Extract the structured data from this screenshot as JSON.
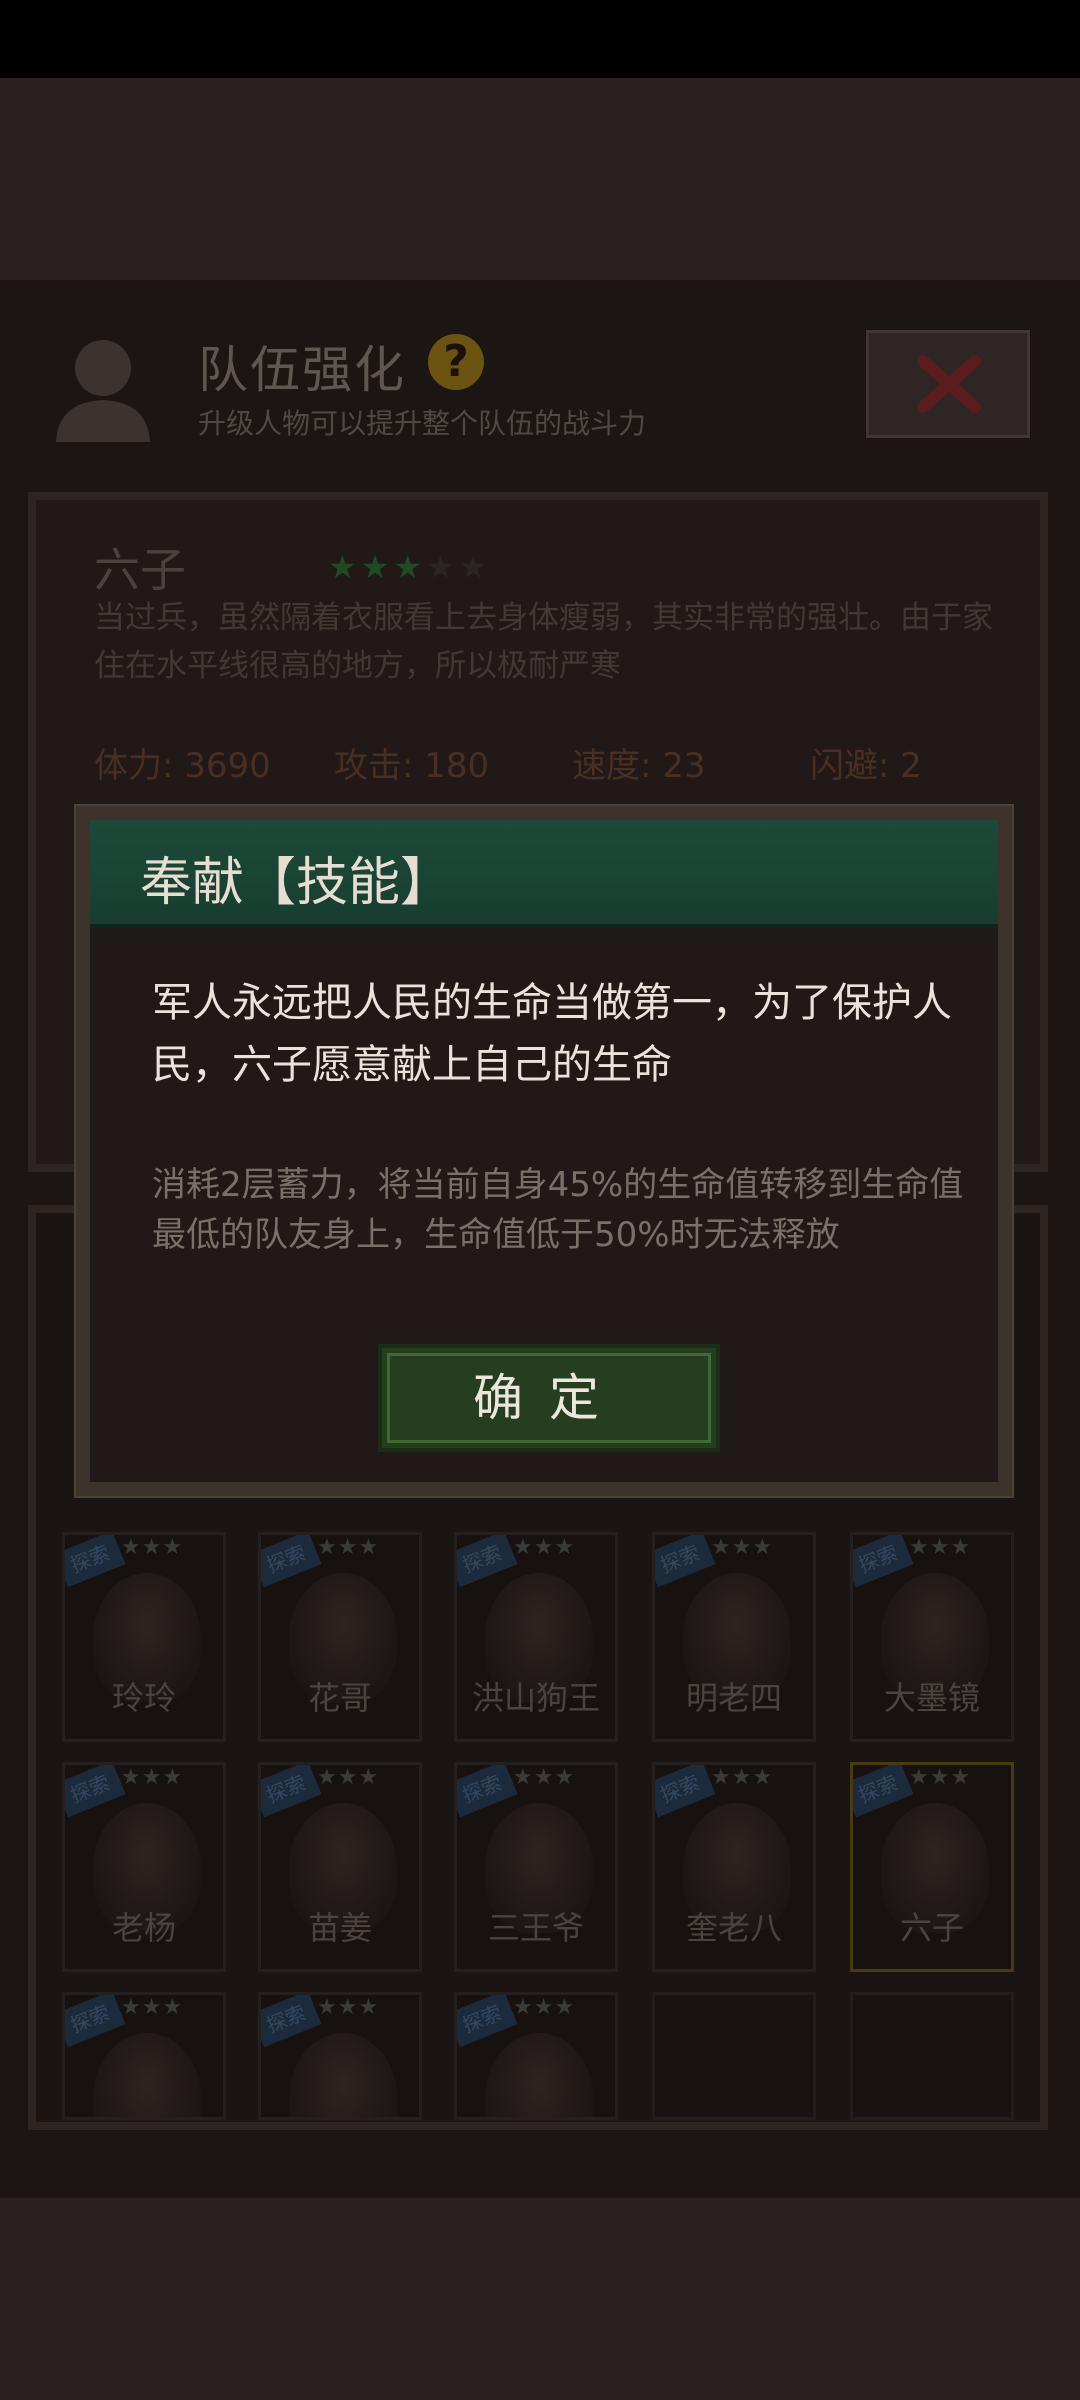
{
  "header": {
    "title": "队伍强化",
    "help_icon": "?",
    "subtitle": "升级人物可以提升整个队伍的战斗力"
  },
  "character": {
    "name": "六子",
    "stars_filled": 3,
    "stars_total": 5,
    "description": "当过兵，虽然隔着衣服看上去身体瘦弱，其实非常的强壮。由于家住在水平线很高的地方，所以极耐严寒",
    "stats": [
      {
        "label": "体力: 3690"
      },
      {
        "label": "攻击: 180"
      },
      {
        "label": "速度: 23"
      },
      {
        "label": "闪避: 2"
      }
    ]
  },
  "roster": {
    "tag_label": "探索",
    "rows": [
      [
        "玲玲",
        "花哥",
        "洪山狗王",
        "明老四",
        "大墨镜"
      ],
      [
        "老杨",
        "苗姜",
        "三王爷",
        "奎老八",
        "六子"
      ],
      [
        "",
        "",
        ""
      ]
    ],
    "selected": "六子"
  },
  "modal": {
    "title": "奉献【技能】",
    "description": "军人永远把人民的生命当做第一，为了保护人民，六子愿意献上自己的生命",
    "detail": "消耗2层蓄力，将当前自身45%的生命值转移到生命值最低的队友身上，生命值低于50%时无法释放",
    "confirm_label": "确定"
  },
  "colors": {
    "modal_header": "#1d4a38",
    "confirm_button": "#263e20",
    "overlay": "#1b1513"
  }
}
